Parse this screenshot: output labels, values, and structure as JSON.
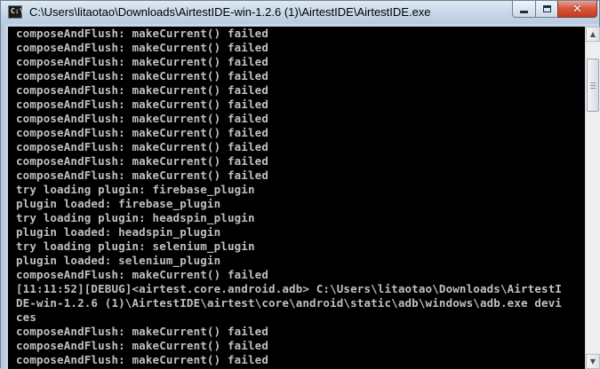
{
  "window": {
    "title": "C:\\Users\\litaotao\\Downloads\\AirtestIDE-win-1.2.6 (1)\\AirtestIDE\\AirtestIDE.exe",
    "icon": "console-icon",
    "buttons": {
      "minimize": "minimize-icon",
      "maximize": "maximize-icon",
      "close": "close-icon",
      "close_glyph": "✕"
    }
  },
  "console": {
    "lines": [
      "composeAndFlush: makeCurrent() failed",
      "composeAndFlush: makeCurrent() failed",
      "composeAndFlush: makeCurrent() failed",
      "composeAndFlush: makeCurrent() failed",
      "composeAndFlush: makeCurrent() failed",
      "composeAndFlush: makeCurrent() failed",
      "composeAndFlush: makeCurrent() failed",
      "composeAndFlush: makeCurrent() failed",
      "composeAndFlush: makeCurrent() failed",
      "composeAndFlush: makeCurrent() failed",
      "composeAndFlush: makeCurrent() failed",
      "try loading plugin: firebase_plugin",
      "plugin loaded: firebase_plugin",
      "try loading plugin: headspin_plugin",
      "plugin loaded: headspin_plugin",
      "try loading plugin: selenium_plugin",
      "plugin loaded: selenium_plugin",
      "composeAndFlush: makeCurrent() failed",
      "[11:11:52][DEBUG]<airtest.core.android.adb> C:\\Users\\litaotao\\Downloads\\AirtestI",
      "DE-win-1.2.6 (1)\\AirtestIDE\\airtest\\core\\android\\static\\adb\\windows\\adb.exe devi",
      "ces",
      "composeAndFlush: makeCurrent() failed",
      "composeAndFlush: makeCurrent() failed",
      "composeAndFlush: makeCurrent() failed"
    ]
  },
  "scrollbar": {
    "up_arrow": "▲",
    "down_arrow": "▼"
  },
  "colors": {
    "console_bg": "#000000",
    "console_text": "#c0c0c0",
    "close_button": "#c8432a"
  }
}
